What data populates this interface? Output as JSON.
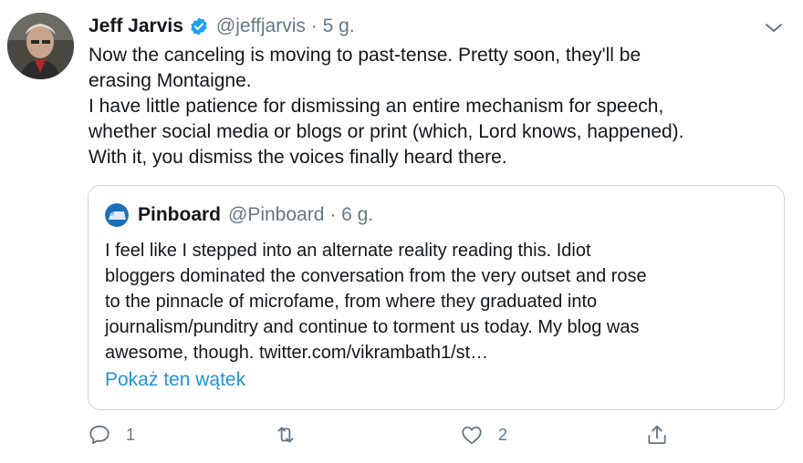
{
  "tweet": {
    "author_name": "Jeff Jarvis",
    "handle": "@jeffjarvis",
    "separator": "·",
    "time": "5 g.",
    "text": "Now the canceling is moving to past-tense. Pretty soon, they'll be\nerasing Montaigne.\nI have little patience for dismissing an entire mechanism for speech,\nwhether social media or blogs or print (which, Lord knows, happened).\nWith it, you dismiss the voices finally heard there.",
    "verified_icon": "verified-badge-icon",
    "more_icon": "chevron-down-icon"
  },
  "quote": {
    "author_name": "Pinboard",
    "handle": "@Pinboard",
    "separator": "·",
    "time": "6 g.",
    "text": "I feel like I stepped into an alternate reality reading this. Idiot\nbloggers dominated the conversation from the very outset and rose\nto the pinnacle of microfame, from where they graduated into\njournalism/punditry and continue to torment us today. My blog was\nawesome, though. twitter.com/vikrambath1/st…",
    "show_thread": "Pokaż ten wątek"
  },
  "actions": {
    "reply_count": "1",
    "retweet_count": "",
    "like_count": "2"
  },
  "colors": {
    "accent": "#1b95e0",
    "secondary_text": "#657786",
    "border": "#ccd6dd",
    "verified": "#1da1f2"
  }
}
